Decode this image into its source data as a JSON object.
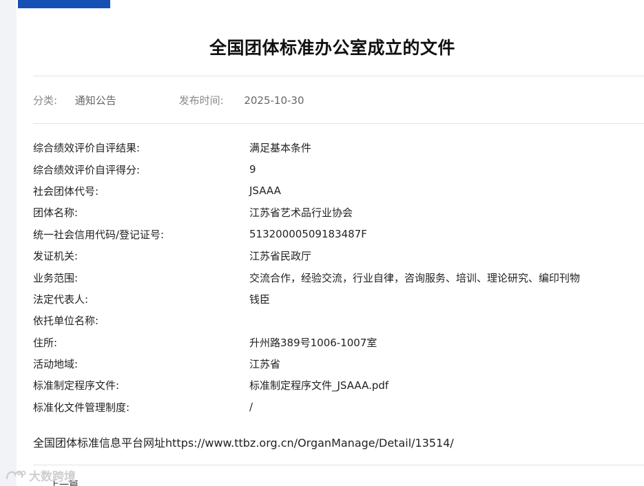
{
  "header": {
    "title": "全国团体标准办公室成立的文件"
  },
  "meta": {
    "category_label": "分类:",
    "category_value": "通知公告",
    "date_label": "发布时间:",
    "date_value": "2025-10-30"
  },
  "info": {
    "rows": [
      {
        "label": "综合绩效评价自评结果:",
        "value": "满足基本条件"
      },
      {
        "label": "综合绩效评价自评得分:",
        "value": "9"
      },
      {
        "label": "社会团体代号:",
        "value": "JSAAA"
      },
      {
        "label": "团体名称:",
        "value": "江苏省艺术品行业协会"
      },
      {
        "label": "统一社会信用代码/登记证号:",
        "value": "51320000509183487F"
      },
      {
        "label": "发证机关:",
        "value": "江苏省民政厅"
      },
      {
        "label": "业务范围:",
        "value": "交流合作，经验交流，行业自律，咨询服务、培训、理论研究、编印刊物"
      },
      {
        "label": "法定代表人:",
        "value": "钱臣"
      },
      {
        "label": "依托单位名称:",
        "value": ""
      },
      {
        "label": "住所:",
        "value": "升州路389号1006-1007室"
      },
      {
        "label": "活动地域:",
        "value": "江苏省"
      },
      {
        "label": "标准制定程序文件:",
        "value": "标准制定程序文件_JSAAA.pdf"
      },
      {
        "label": "标准化文件管理制度:",
        "value": "/"
      }
    ]
  },
  "source": {
    "text": "全国团体标准信息平台网址https://www.ttbz.org.cn/OrganManage/Detail/13514/"
  },
  "watermark": {
    "text": "大数跨境"
  },
  "footer_cut": {
    "text": "上一篇"
  },
  "colors": {
    "accent": "#1650b5",
    "left_strip": "#f1f3f6",
    "divider": "#e3e3e3"
  }
}
